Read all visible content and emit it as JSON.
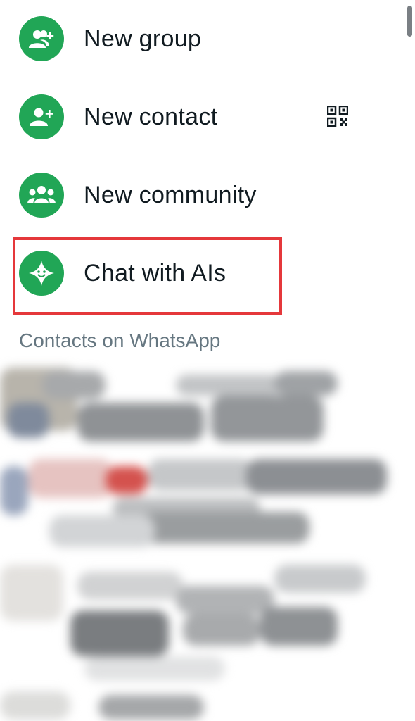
{
  "menu": {
    "items": [
      {
        "label": "New group",
        "icon": "group-add-icon"
      },
      {
        "label": "New contact",
        "icon": "person-add-icon"
      },
      {
        "label": "New community",
        "icon": "community-icon"
      },
      {
        "label": "Chat with AIs",
        "icon": "ai-sparkle-icon"
      }
    ],
    "qr_icon": "qr-code-icon"
  },
  "section": {
    "contacts_header": "Contacts on WhatsApp"
  },
  "colors": {
    "accent": "#21a656",
    "highlight": "#e5383b",
    "text_primary": "#111b21",
    "text_secondary": "#667781"
  }
}
